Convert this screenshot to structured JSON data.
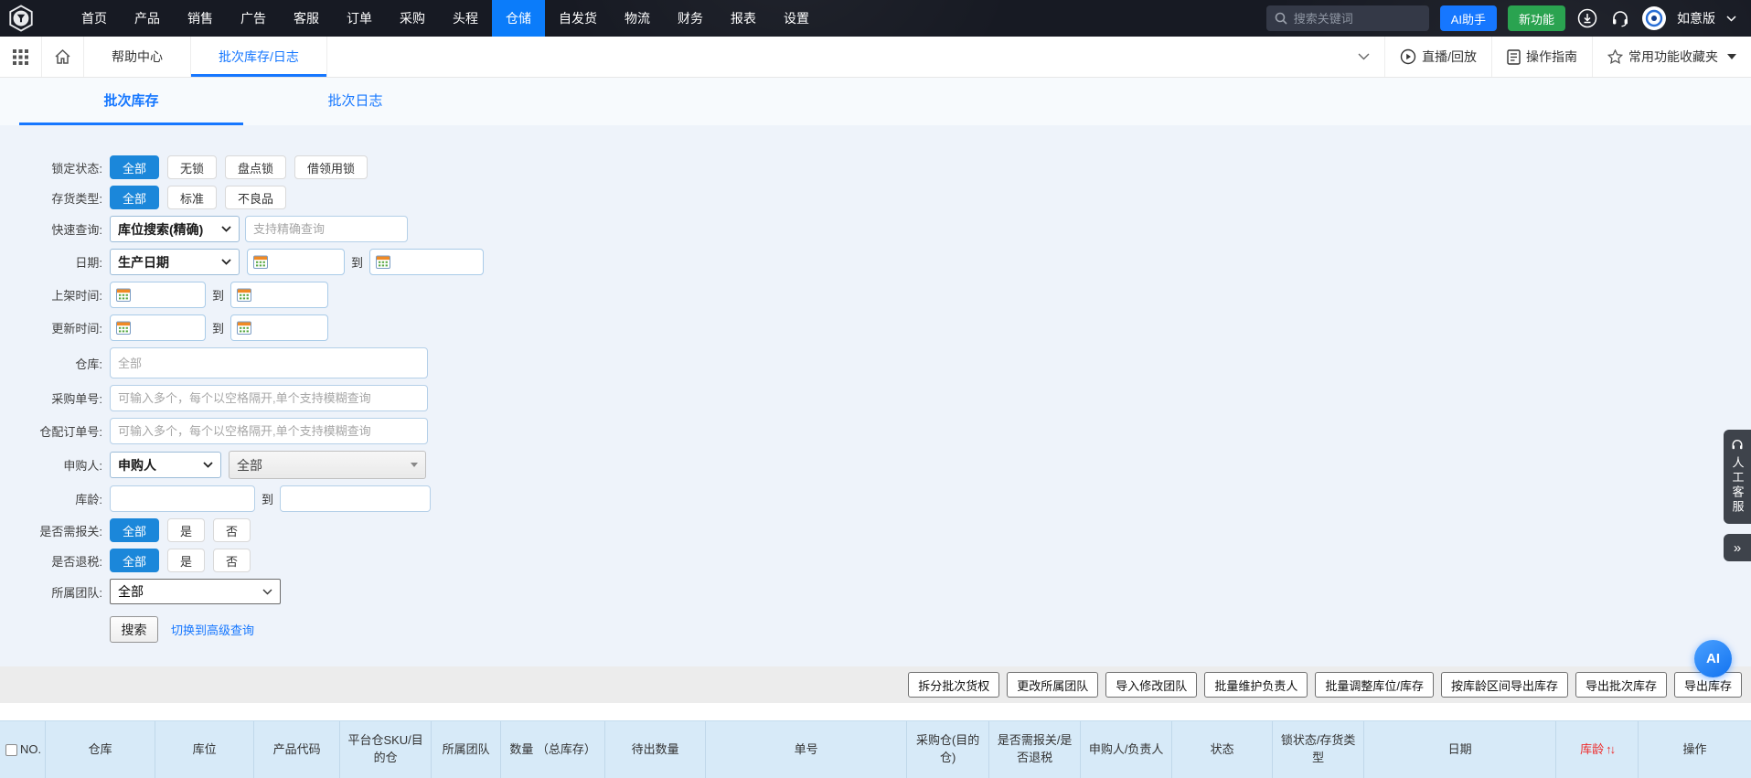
{
  "navbar": {
    "menu": [
      "首页",
      "产品",
      "销售",
      "广告",
      "客服",
      "订单",
      "采购",
      "头程",
      "仓储",
      "自发货",
      "物流",
      "财务",
      "报表",
      "设置"
    ],
    "active_item": "仓储",
    "search_placeholder": "搜索关键词",
    "ai_assistant": "AI助手",
    "new_feature": "新功能",
    "version": "如意版"
  },
  "tabbar": {
    "help_center": "帮助中心",
    "current_page": "批次库存/日志",
    "live_replay": "直播/回放",
    "operation_guide": "操作指南",
    "favorites": "常用功能收藏夹"
  },
  "subtabs": {
    "batch_inventory": "批次库存",
    "batch_log": "批次日志"
  },
  "filters": {
    "to": "到",
    "lock_status": {
      "label": "锁定状态:",
      "options": [
        "全部",
        "无锁",
        "盘点锁",
        "借领用锁"
      ],
      "selected": "全部"
    },
    "stock_type": {
      "label": "存货类型:",
      "options": [
        "全部",
        "标准",
        "不良品"
      ],
      "selected": "全部"
    },
    "quick_search": {
      "label": "快速查询:",
      "select_value": "库位搜索(精确)",
      "input_placeholder": "支持精确查询"
    },
    "date": {
      "label": "日期:",
      "select_value": "生产日期"
    },
    "shelf_time": {
      "label": "上架时间:"
    },
    "update_time": {
      "label": "更新时间:"
    },
    "warehouse": {
      "label": "仓库:",
      "placeholder": "全部"
    },
    "purchase_no": {
      "label": "采购单号:",
      "placeholder": "可输入多个，每个以空格隔开,单个支持模糊查询"
    },
    "fulfill_order_no": {
      "label": "仓配订单号:",
      "placeholder": "可输入多个，每个以空格隔开,单个支持模糊查询"
    },
    "requester": {
      "label": "申购人:",
      "select_value": "申购人",
      "person_value": "全部"
    },
    "stock_age": {
      "label": "库龄:"
    },
    "need_customs": {
      "label": "是否需报关:",
      "options": [
        "全部",
        "是",
        "否"
      ],
      "selected": "全部"
    },
    "tax_refund": {
      "label": "是否退税:",
      "options": [
        "全部",
        "是",
        "否"
      ],
      "selected": "全部"
    },
    "team": {
      "label": "所属团队:",
      "select_value": "全部"
    },
    "search_button": "搜索",
    "advanced_link": "切换到高级查询"
  },
  "actions": [
    "拆分批次货权",
    "更改所属团队",
    "导入修改团队",
    "批量维护负责人",
    "批量调整库位/库存",
    "按库龄区间导出库存",
    "导出批次库存",
    "导出库存"
  ],
  "table": {
    "columns": [
      "NO.",
      "仓库",
      "库位",
      "产品代码",
      "平台仓SKU/目的仓",
      "所属团队",
      "数量 （总库存）",
      "待出数量",
      "单号",
      "采购仓(目的仓)",
      "是否需报关/是否退税",
      "申购人/负责人",
      "状态",
      "锁状态/存货类型",
      "日期",
      "库龄",
      "操作"
    ],
    "sort_column": "库龄",
    "sort_icon": "↑↓"
  },
  "floating": {
    "service_label": "人工客服",
    "collapse_icon": "»",
    "ai_label": "AI"
  },
  "colors": {
    "accent": "#1677ff",
    "toggle_active": "#1b87da",
    "navbar_bg": "#171a23",
    "green_button": "#2aa350",
    "table_header_bg": "#d7eaf8",
    "age_red": "#ee2c2c"
  },
  "icons": {
    "search": "magnifier",
    "download": "circle-arrow-down",
    "headset": "headset",
    "grid": "app-grid",
    "home": "house",
    "play": "circle-play",
    "guide": "document",
    "favorites": "star",
    "calendar": "calendar",
    "chevron": "chevron-down",
    "service": "headset",
    "ai_float": "AI"
  }
}
